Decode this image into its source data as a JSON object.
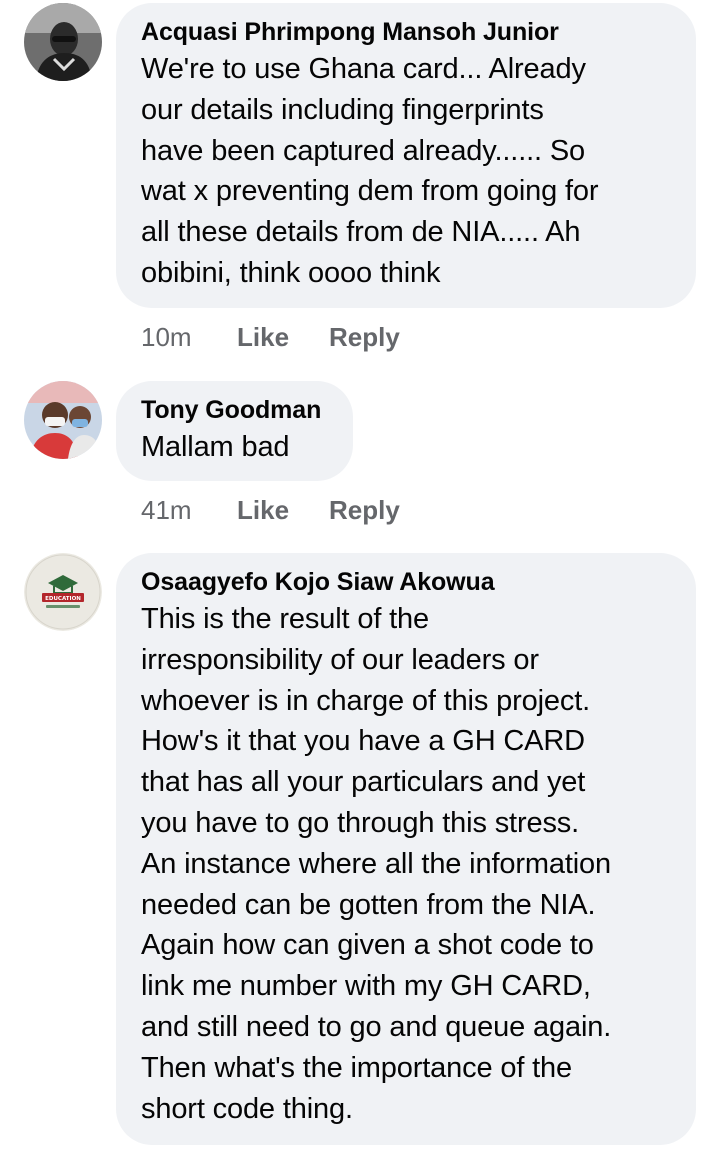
{
  "comments": [
    {
      "author": "Acquasi Phrimpong Mansoh Junior",
      "avatar_icon": "profile-photo-man-icon",
      "text": "We're to use Ghana card... Already\nour details including fingerprints\nhave been captured already...... So\nwat x preventing dem from going for\nall these details from de NIA..... Ah\nobibini, think oooo think",
      "time": "10m",
      "like_label": "Like",
      "reply_label": "Reply"
    },
    {
      "author": "Tony Goodman",
      "avatar_icon": "profile-photo-masked-men-icon",
      "text": "Mallam bad",
      "time": "41m",
      "like_label": "Like",
      "reply_label": "Reply"
    },
    {
      "author": "Osaagyefo Kojo Siaw Akowua",
      "avatar_icon": "education-logo-icon",
      "avatar_logo_text": "EDUCATION",
      "text": "This is the result of the\nirresponsibility of our leaders or\nwhoever is in charge of this project.\nHow's it that you have a GH CARD\nthat has all your particulars and yet\nyou have to go through this stress.\nAn instance where all the information\nneeded can be gotten from the NIA.\nAgain how can given a shot code to\nlink me number with my GH CARD,\nand still need to go and queue again.\nThen what's the importance of the\nshort code thing."
    }
  ],
  "colors": {
    "bubble": "#f0f2f5",
    "text": "#050505",
    "meta": "#65676b",
    "logo_red": "#b3262b",
    "logo_green": "#2f6a3a"
  }
}
